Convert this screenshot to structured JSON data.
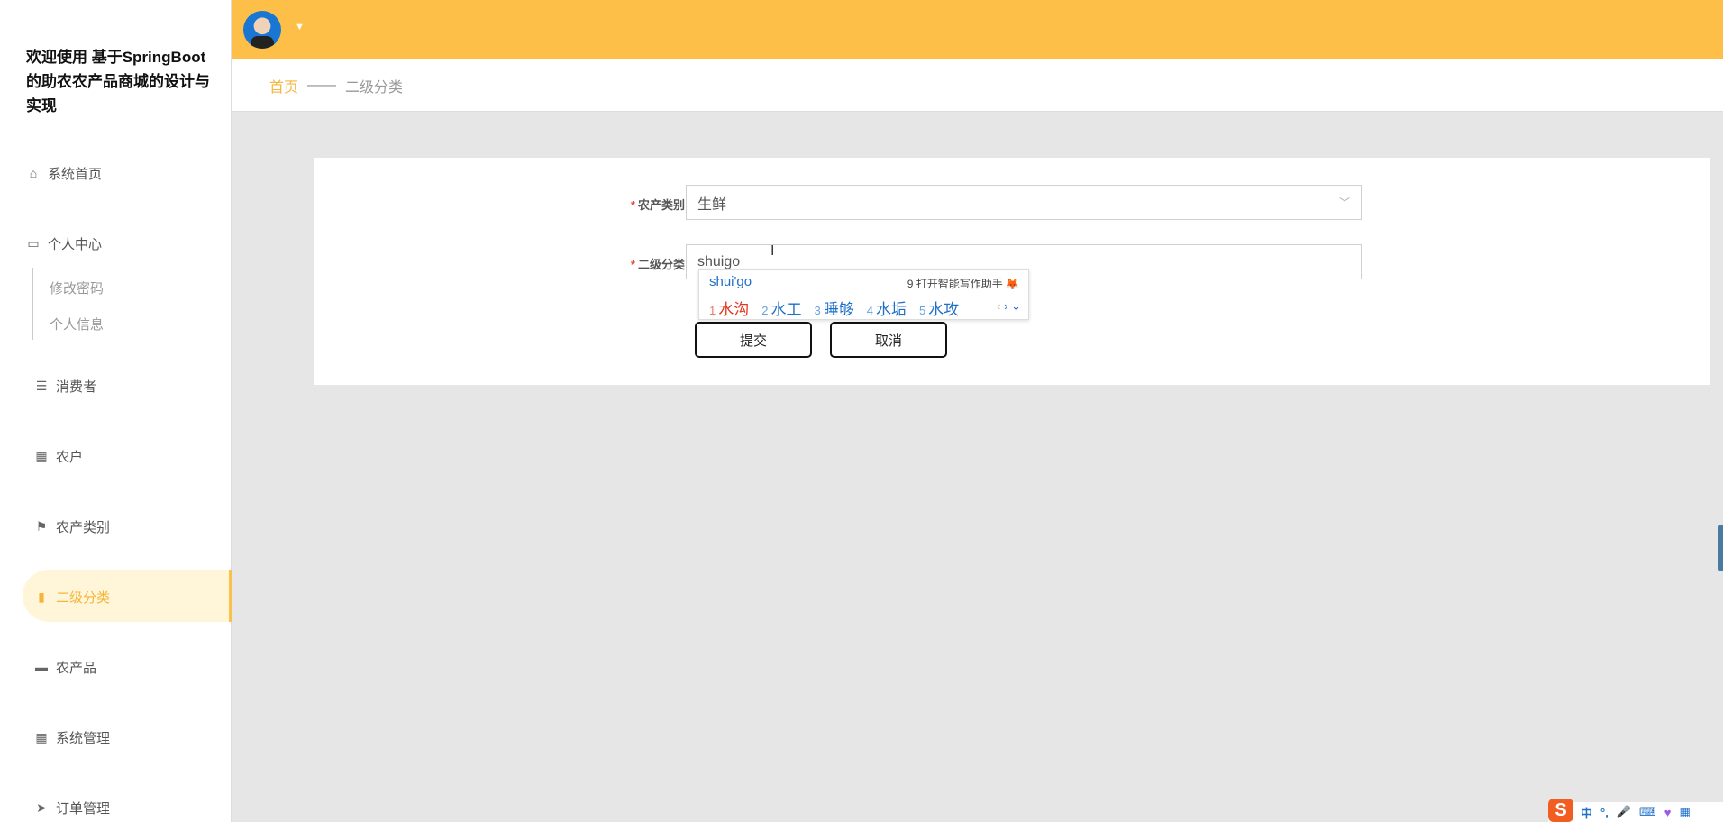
{
  "app_title": "欢迎使用 基于SpringBoot的助农农产品商城的设计与实现",
  "colors": {
    "accent": "#fdbf47",
    "active_bg": "#fff6d9",
    "required": "#e74c3c"
  },
  "sidebar": {
    "items": [
      {
        "label": "系统首页",
        "icon": "home-icon"
      },
      {
        "label": "个人中心",
        "icon": "wallet-icon",
        "children": [
          "修改密码",
          "个人信息"
        ]
      },
      {
        "label": "消费者",
        "icon": "list-icon"
      },
      {
        "label": "农户",
        "icon": "grid-icon"
      },
      {
        "label": "农产类别",
        "icon": "flag-icon"
      },
      {
        "label": "二级分类",
        "icon": "bar-chart-icon",
        "active": true
      },
      {
        "label": "农产品",
        "icon": "store-icon"
      },
      {
        "label": "系统管理",
        "icon": "grid-icon"
      },
      {
        "label": "订单管理",
        "icon": "send-icon"
      }
    ]
  },
  "breadcrumb": {
    "home": "首页",
    "separator": "——",
    "current": "二级分类"
  },
  "form": {
    "category_label": "农产类别",
    "category_value": "生鲜",
    "subcategory_label": "二级分类",
    "subcategory_value": "shuigo",
    "submit": "提交",
    "cancel": "取消"
  },
  "ime": {
    "pinyin": "shui'go",
    "assist": "9 打开智能写作助手",
    "candidates": [
      {
        "n": "1",
        "t": "水沟"
      },
      {
        "n": "2",
        "t": "水工"
      },
      {
        "n": "3",
        "t": "睡够"
      },
      {
        "n": "4",
        "t": "水垢"
      },
      {
        "n": "5",
        "t": "水攻"
      }
    ]
  },
  "tray": {
    "logo": "S",
    "mode": "中",
    "punct": "°,"
  }
}
